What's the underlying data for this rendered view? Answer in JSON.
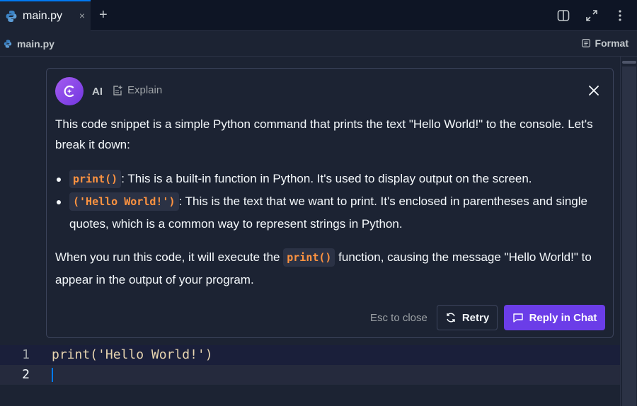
{
  "tab": {
    "label": "main.py",
    "close": "×",
    "add": "+"
  },
  "breadcrumb": {
    "file": "main.py",
    "format_label": "Format"
  },
  "ai_panel": {
    "name": "AI",
    "mode": "Explain",
    "paragraph1": "This code snippet is a simple Python command that prints the text \"Hello World!\" to the console. Let's break it down:",
    "bullets": [
      {
        "code": "print()",
        "text": ": This is a built-in function in Python. It's used to display output on the screen."
      },
      {
        "code": "('Hello World!')",
        "text": ": This is the text that we want to print. It's enclosed in parentheses and single quotes, which is a common way to represent strings in Python."
      }
    ],
    "paragraph3": {
      "before": "When you run this code, it will execute the ",
      "code": "print()",
      "after": " function, causing the message \"Hello World!\" to appear in the output of your program."
    },
    "esc_label": "Esc to close",
    "retry_label": "Retry",
    "reply_label": "Reply in Chat"
  },
  "editor": {
    "lines": [
      {
        "number": "1",
        "code": "print('Hello World!')"
      },
      {
        "number": "2",
        "code": ""
      }
    ]
  },
  "colors": {
    "accent": "#0079f2",
    "primary_button": "#6b3de8",
    "code_highlight": "#ff9340"
  }
}
